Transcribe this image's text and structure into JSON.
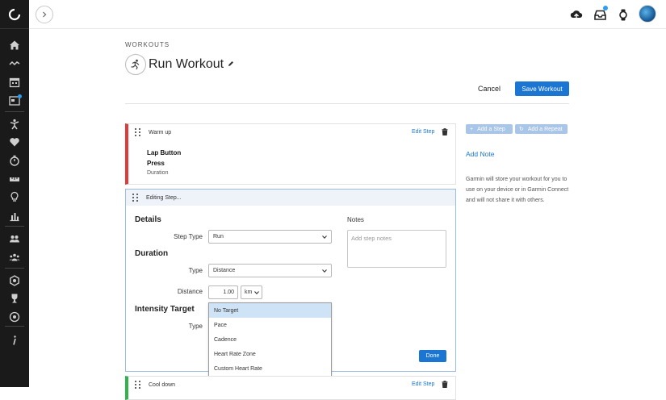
{
  "breadcrumb": "WORKOUTS",
  "title": "Run Workout",
  "header": {
    "cancel_label": "Cancel",
    "save_label": "Save Workout"
  },
  "colors": {
    "accent": "#1a76d2",
    "warmup": "#e03a3a",
    "cooldown": "#2fb34a",
    "sidebar": "#1a1a1a"
  },
  "sidebar": {
    "icons": [
      "home-icon",
      "activity-icon",
      "calendar-icon",
      "reports-icon",
      "running-person-icon",
      "heart-icon",
      "stopwatch-icon",
      "ruler-icon",
      "bulb-icon",
      "bar-chart-icon",
      "group-icon",
      "connections-icon",
      "badge-icon",
      "trophy-icon",
      "target-icon",
      "info-icon"
    ]
  },
  "topbar": {
    "icons": [
      "upload-cloud-icon",
      "inbox-icon",
      "watch-icon"
    ]
  },
  "steps": {
    "warmup": {
      "name": "Warm up",
      "edit_label": "Edit Step",
      "line1": "Lap Button",
      "line2": "Press",
      "line3": "Duration"
    },
    "editing": {
      "header": "Editing Step...",
      "details_title": "Details",
      "step_type_label": "Step Type",
      "step_type_value": "Run",
      "duration_title": "Duration",
      "duration_type_label": "Type",
      "duration_type_value": "Distance",
      "distance_label": "Distance",
      "distance_value": "1.00",
      "distance_unit": "km",
      "intensity_title": "Intensity Target",
      "intensity_type_label": "Type",
      "notes_label": "Notes",
      "notes_placeholder": "Add step notes",
      "done_label": "Done",
      "target_options": [
        "No Target",
        "Pace",
        "Cadence",
        "Heart Rate Zone",
        "Custom Heart Rate"
      ],
      "target_selected": "No Target"
    },
    "cooldown": {
      "name": "Cool down",
      "edit_label": "Edit Step"
    }
  },
  "right": {
    "add_step_label": "Add a Step",
    "add_repeat_label": "Add a Repeat",
    "add_note_label": "Add Note",
    "info": "Garmin will store your workout for you to use on your device or in Garmin Connect and will not share it with others."
  }
}
